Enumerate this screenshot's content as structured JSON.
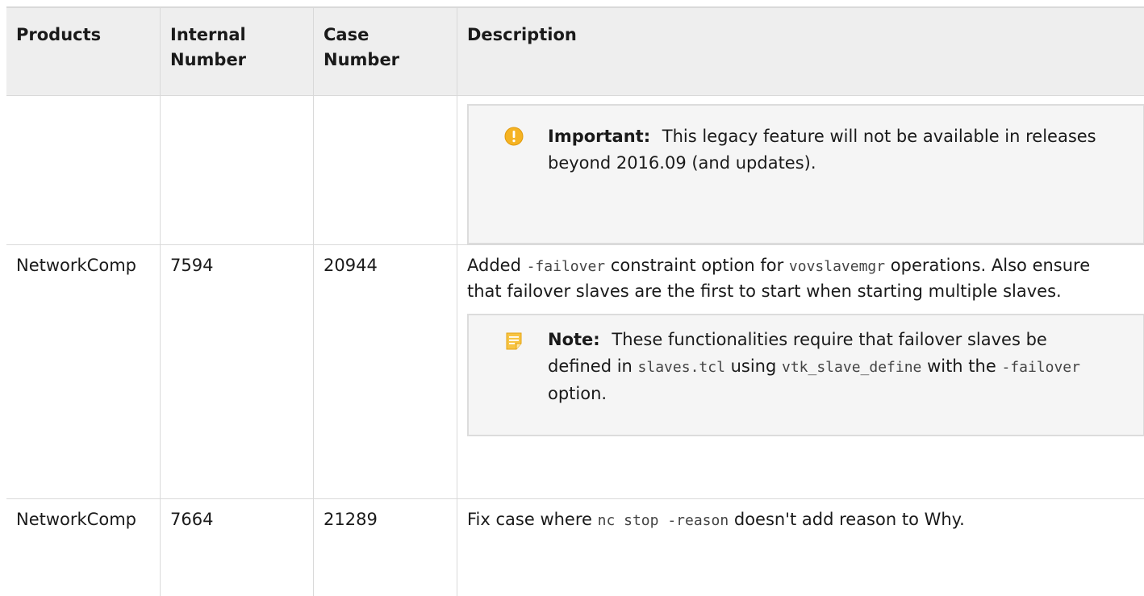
{
  "table": {
    "headers": {
      "products": "Products",
      "internal_number": "Internal Number",
      "case_number": "Case Number",
      "description": "Description"
    },
    "row1": {
      "important_label": "Important:",
      "important_text": "This legacy feature will not be available in releases beyond 2016.09 (and updates)."
    },
    "row2": {
      "product": "NetworkComp",
      "internal_number": "7594",
      "case_number": "20944",
      "desc_1": "Added ",
      "desc_code_1": "-failover",
      "desc_2": " constraint option for ",
      "desc_code_2": "vovslavemgr",
      "desc_3": " operations. Also ensure that failover slaves are the first to start when starting multiple slaves.",
      "note_label": "Note:",
      "note_1": "These functionalities require that failover slaves be defined in ",
      "note_code_1": "slaves.tcl",
      "note_2": " using ",
      "note_code_2": "vtk_slave_define",
      "note_3": " with the ",
      "note_code_3": "-failover",
      "note_4": " option."
    },
    "row3": {
      "product": "NetworkComp",
      "internal_number": "7664",
      "case_number": "21289",
      "desc_1": "Fix case where ",
      "desc_code_1": "nc stop -reason",
      "desc_2": " doesn't add reason to Why."
    }
  },
  "colors": {
    "important_icon": "#f5b323",
    "note_icon": "#f2b21c",
    "header_bg": "#eeeeee",
    "callout_bg": "#f5f5f5"
  },
  "icons": {
    "important": "exclamation-circle-icon",
    "note": "note-icon"
  }
}
